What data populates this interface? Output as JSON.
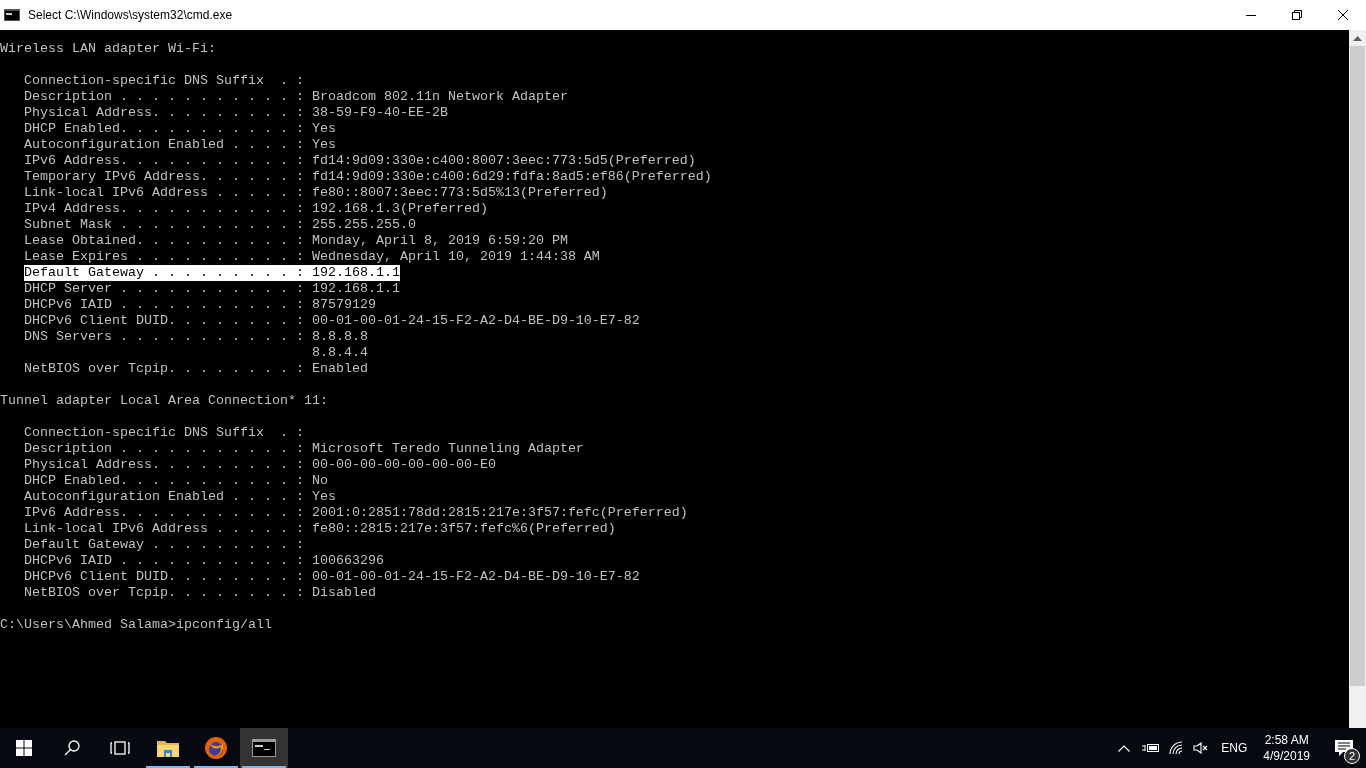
{
  "window": {
    "title": "Select C:\\Windows\\system32\\cmd.exe"
  },
  "console": {
    "sections": [
      {
        "heading": "Wireless LAN adapter Wi-Fi:",
        "entries": [
          {
            "kind": "entry",
            "text": "Connection-specific DNS Suffix  . :",
            "selected": false
          },
          {
            "kind": "entry",
            "text": "Description . . . . . . . . . . . : Broadcom 802.11n Network Adapter",
            "selected": false
          },
          {
            "kind": "entry",
            "text": "Physical Address. . . . . . . . . : 38-59-F9-40-EE-2B",
            "selected": false
          },
          {
            "kind": "entry",
            "text": "DHCP Enabled. . . . . . . . . . . : Yes",
            "selected": false
          },
          {
            "kind": "entry",
            "text": "Autoconfiguration Enabled . . . . : Yes",
            "selected": false
          },
          {
            "kind": "entry",
            "text": "IPv6 Address. . . . . . . . . . . : fd14:9d09:330e:c400:8007:3eec:773:5d5(Preferred)",
            "selected": false
          },
          {
            "kind": "entry",
            "text": "Temporary IPv6 Address. . . . . . : fd14:9d09:330e:c400:6d29:fdfa:8ad5:ef86(Preferred)",
            "selected": false
          },
          {
            "kind": "entry",
            "text": "Link-local IPv6 Address . . . . . : fe80::8007:3eec:773:5d5%13(Preferred)",
            "selected": false
          },
          {
            "kind": "entry",
            "text": "IPv4 Address. . . . . . . . . . . : 192.168.1.3(Preferred)",
            "selected": false
          },
          {
            "kind": "entry",
            "text": "Subnet Mask . . . . . . . . . . . : 255.255.255.0",
            "selected": false
          },
          {
            "kind": "entry",
            "text": "Lease Obtained. . . . . . . . . . : Monday, April 8, 2019 6:59:20 PM",
            "selected": false
          },
          {
            "kind": "entry",
            "text": "Lease Expires . . . . . . . . . . : Wednesday, April 10, 2019 1:44:38 AM",
            "selected": false
          },
          {
            "kind": "entry",
            "text": "Default Gateway . . . . . . . . . : 192.168.1.1",
            "selected": true
          },
          {
            "kind": "entry",
            "text": "DHCP Server . . . . . . . . . . . : 192.168.1.1",
            "selected": false
          },
          {
            "kind": "entry",
            "text": "DHCPv6 IAID . . . . . . . . . . . : 87579129",
            "selected": false
          },
          {
            "kind": "entry",
            "text": "DHCPv6 Client DUID. . . . . . . . : 00-01-00-01-24-15-F2-A2-D4-BE-D9-10-E7-82",
            "selected": false
          },
          {
            "kind": "entry",
            "text": "DNS Servers . . . . . . . . . . . : 8.8.8.8",
            "selected": false
          },
          {
            "kind": "continuation",
            "text": "8.8.4.4",
            "selected": false
          },
          {
            "kind": "entry",
            "text": "NetBIOS over Tcpip. . . . . . . . : Enabled",
            "selected": false
          }
        ]
      },
      {
        "heading": "Tunnel adapter Local Area Connection* 11:",
        "entries": [
          {
            "kind": "entry",
            "text": "Connection-specific DNS Suffix  . :",
            "selected": false
          },
          {
            "kind": "entry",
            "text": "Description . . . . . . . . . . . : Microsoft Teredo Tunneling Adapter",
            "selected": false
          },
          {
            "kind": "entry",
            "text": "Physical Address. . . . . . . . . : 00-00-00-00-00-00-00-E0",
            "selected": false
          },
          {
            "kind": "entry",
            "text": "DHCP Enabled. . . . . . . . . . . : No",
            "selected": false
          },
          {
            "kind": "entry",
            "text": "Autoconfiguration Enabled . . . . : Yes",
            "selected": false
          },
          {
            "kind": "entry",
            "text": "IPv6 Address. . . . . . . . . . . : 2001:0:2851:78dd:2815:217e:3f57:fefc(Preferred)",
            "selected": false
          },
          {
            "kind": "entry",
            "text": "Link-local IPv6 Address . . . . . : fe80::2815:217e:3f57:fefc%6(Preferred)",
            "selected": false
          },
          {
            "kind": "entry",
            "text": "Default Gateway . . . . . . . . . :",
            "selected": false
          },
          {
            "kind": "entry",
            "text": "DHCPv6 IAID . . . . . . . . . . . : 100663296",
            "selected": false
          },
          {
            "kind": "entry",
            "text": "DHCPv6 Client DUID. . . . . . . . : 00-01-00-01-24-15-F2-A2-D4-BE-D9-10-E7-82",
            "selected": false
          },
          {
            "kind": "entry",
            "text": "NetBIOS over Tcpip. . . . . . . . : Disabled",
            "selected": false
          }
        ]
      }
    ],
    "prompt": "C:\\Users\\Ahmed Salama>ipconfig/all"
  },
  "taskbar": {
    "apps": [
      {
        "kind": "folder",
        "running": true,
        "selected": false
      },
      {
        "kind": "browser",
        "running": true,
        "selected": false
      },
      {
        "kind": "terminal",
        "running": true,
        "selected": true
      }
    ],
    "tray": {
      "language": "ENG",
      "time": "2:58 AM",
      "date": "4/9/2019",
      "notification_count": "2"
    }
  }
}
